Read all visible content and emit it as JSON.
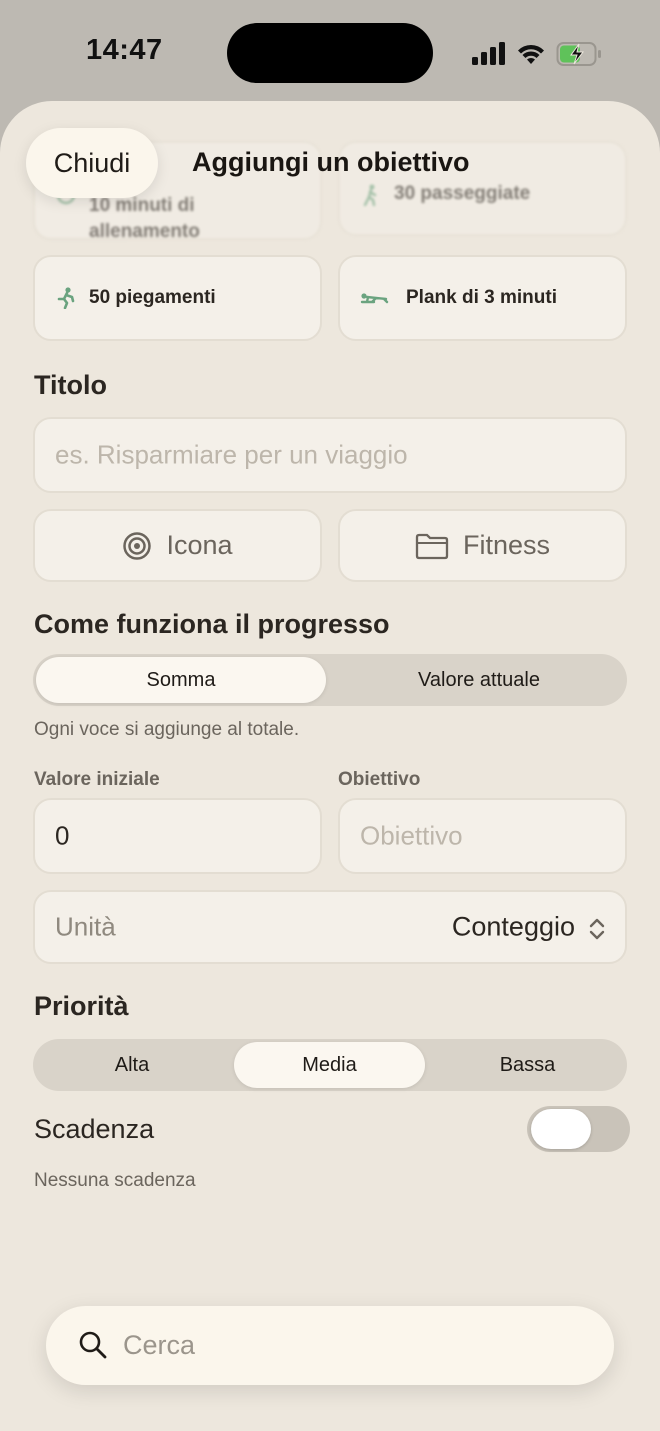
{
  "status": {
    "time": "14:47"
  },
  "header": {
    "close_label": "Chiudi",
    "title": "Aggiungi un obiettivo"
  },
  "suggestions": [
    {
      "label": "10 minuti di allenamento",
      "icon": "figure-icon"
    },
    {
      "label": "30 passeggiate",
      "icon": "walk-icon"
    },
    {
      "label": "50 piegamenti",
      "icon": "pushup-icon"
    },
    {
      "label": "Plank di 3 minuti",
      "icon": "plank-icon"
    }
  ],
  "title_section": {
    "heading": "Titolo",
    "placeholder": "es. Risparmiare per un viaggio",
    "icon_label": "Icona",
    "category_label": "Fitness"
  },
  "progress": {
    "heading": "Come funziona il progresso",
    "options": [
      "Somma",
      "Valore attuale"
    ],
    "selected": "Somma",
    "hint": "Ogni voce si aggiunge al totale."
  },
  "values": {
    "initial_label": "Valore iniziale",
    "initial_value": "0",
    "target_label": "Obiettivo",
    "target_placeholder": "Obiettivo",
    "unit_label": "Unità",
    "unit_value": "Conteggio"
  },
  "priority": {
    "heading": "Priorità",
    "options": [
      "Alta",
      "Media",
      "Bassa"
    ],
    "selected": "Media"
  },
  "deadline": {
    "label": "Scadenza",
    "enabled": false,
    "hint": "Nessuna scadenza"
  },
  "search": {
    "placeholder": "Cerca"
  },
  "colors": {
    "background": "#ede7dd",
    "card": "#f4f0e9",
    "accent_green": "#6aa37f"
  }
}
